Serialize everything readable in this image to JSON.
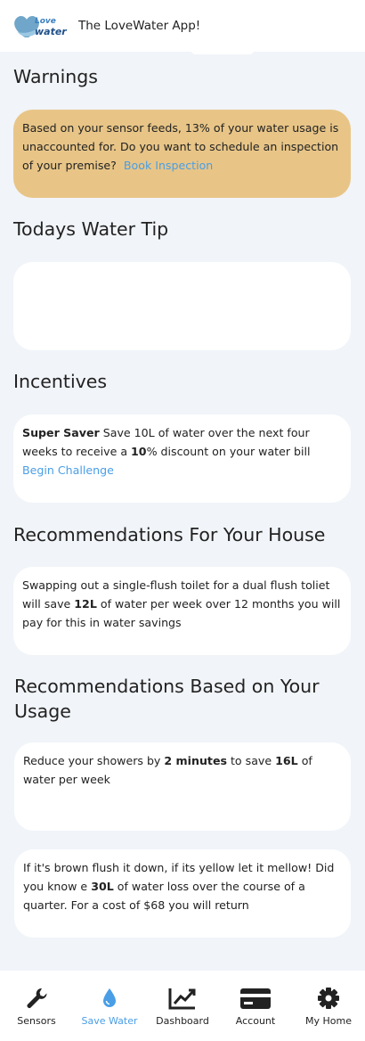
{
  "header": {
    "logo_text_top": "Love",
    "logo_text_bottom": "water",
    "title": "The LoveWater App!"
  },
  "warnings": {
    "title": "Warnings",
    "text": "Based on your sensor feeds, 13% of your water usage is unaccounted for. Do you want to schedule an inspection of your premise?",
    "link": "Book Inspection"
  },
  "tip": {
    "title": "Todays Water Tip",
    "text": ""
  },
  "incentives": {
    "title": "Incentives",
    "name": "Super Saver",
    "text_a": "Save 10L of water over the next four weeks to receive a ",
    "bold": "10",
    "text_b": "% discount on your water bill ",
    "link": "Begin Challenge"
  },
  "house": {
    "title": "Recommendations For Your House",
    "text_a": "Swapping out a single-flush toilet for a dual flush toliet will save ",
    "bold": "12L",
    "text_b": " of water per week over 12 months you will pay for this in water savings"
  },
  "usage": {
    "title": "Recommendations Based on Your Usage",
    "card1": {
      "text_a": "Reduce your showers by ",
      "bold1": "2 minutes",
      "text_b": " to save ",
      "bold2": "16L",
      "text_c": " of water per week"
    },
    "card2": {
      "text_a": "If it's brown flush it down, if its yellow let it mellow! Did you know e ",
      "bold": "30L",
      "text_b": " of water loss over the course of a quarter. For a cost of $68 you will return"
    }
  },
  "nav": {
    "items": [
      {
        "label": "Sensors",
        "icon": "wrench-icon"
      },
      {
        "label": "Save Water",
        "icon": "water-drop-icon"
      },
      {
        "label": "Dashboard",
        "icon": "chart-line-icon"
      },
      {
        "label": "Account",
        "icon": "credit-card-icon"
      },
      {
        "label": "My Home",
        "icon": "gear-icon"
      }
    ],
    "active_color": "#4a9ee6"
  },
  "colors": {
    "warning_card": "#e8c587",
    "background": "#f1f4f8",
    "link": "#4a9ee6"
  }
}
